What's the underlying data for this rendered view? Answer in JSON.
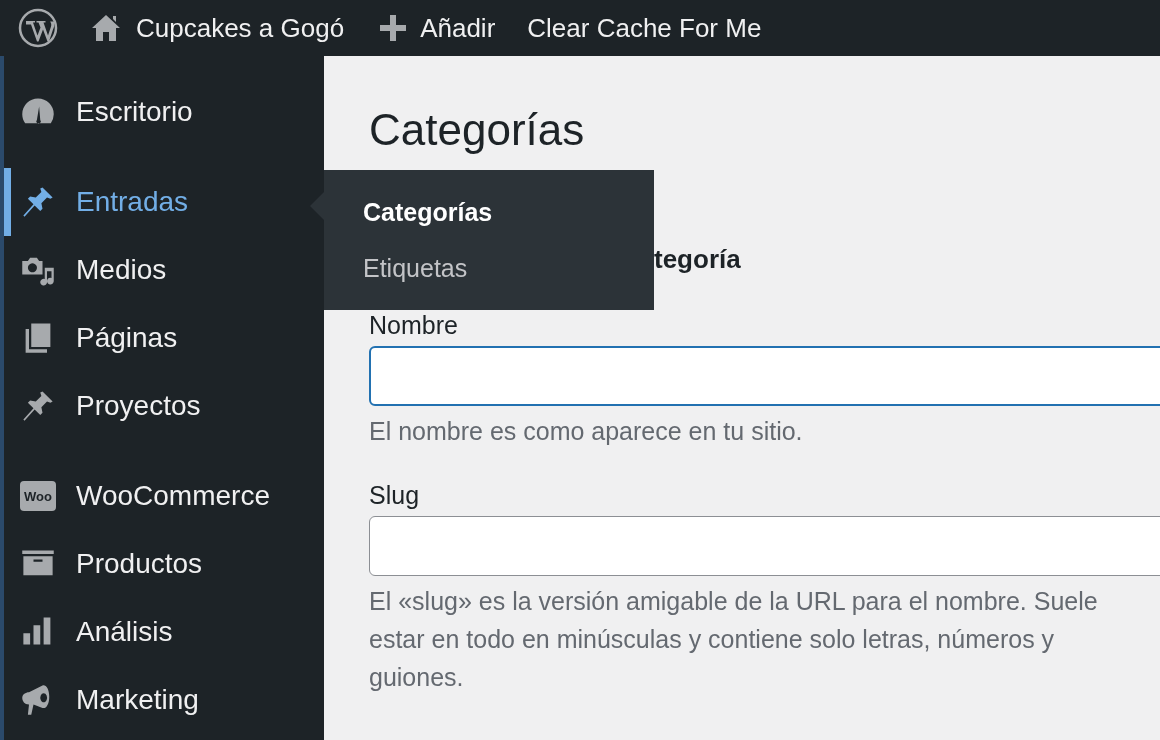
{
  "top_bar": {
    "site_name": "Cupcakes a Gogó",
    "add_label": "Añadir",
    "cache_label": "Clear Cache For Me"
  },
  "sidebar": {
    "groups": [
      [
        {
          "label": "Escritorio",
          "selected": false
        }
      ],
      [
        {
          "label": "Entradas",
          "selected": true
        },
        {
          "label": "Medios",
          "selected": false
        },
        {
          "label": "Páginas",
          "selected": false
        },
        {
          "label": "Proyectos",
          "selected": false
        }
      ],
      [
        {
          "label": "WooCommerce",
          "selected": false,
          "icon_text": "Woo"
        },
        {
          "label": "Productos",
          "selected": false
        },
        {
          "label": "Análisis",
          "selected": false
        },
        {
          "label": "Marketing",
          "selected": false
        }
      ]
    ]
  },
  "flyout": {
    "items": [
      {
        "label": "Categorías",
        "selected": true
      },
      {
        "label": "Etiquetas",
        "selected": false
      }
    ]
  },
  "page": {
    "title": "Categorías",
    "section_heading_visible": "tegoría",
    "fields": [
      {
        "label": "Nombre",
        "focused": true,
        "help": "El nombre es como aparece en tu sitio."
      },
      {
        "label": "Slug",
        "focused": false,
        "help": "El «slug» es la versión amigable de la URL para el nombre. Suele estar en todo en minúsculas y contiene solo letras, números y guiones."
      }
    ]
  }
}
